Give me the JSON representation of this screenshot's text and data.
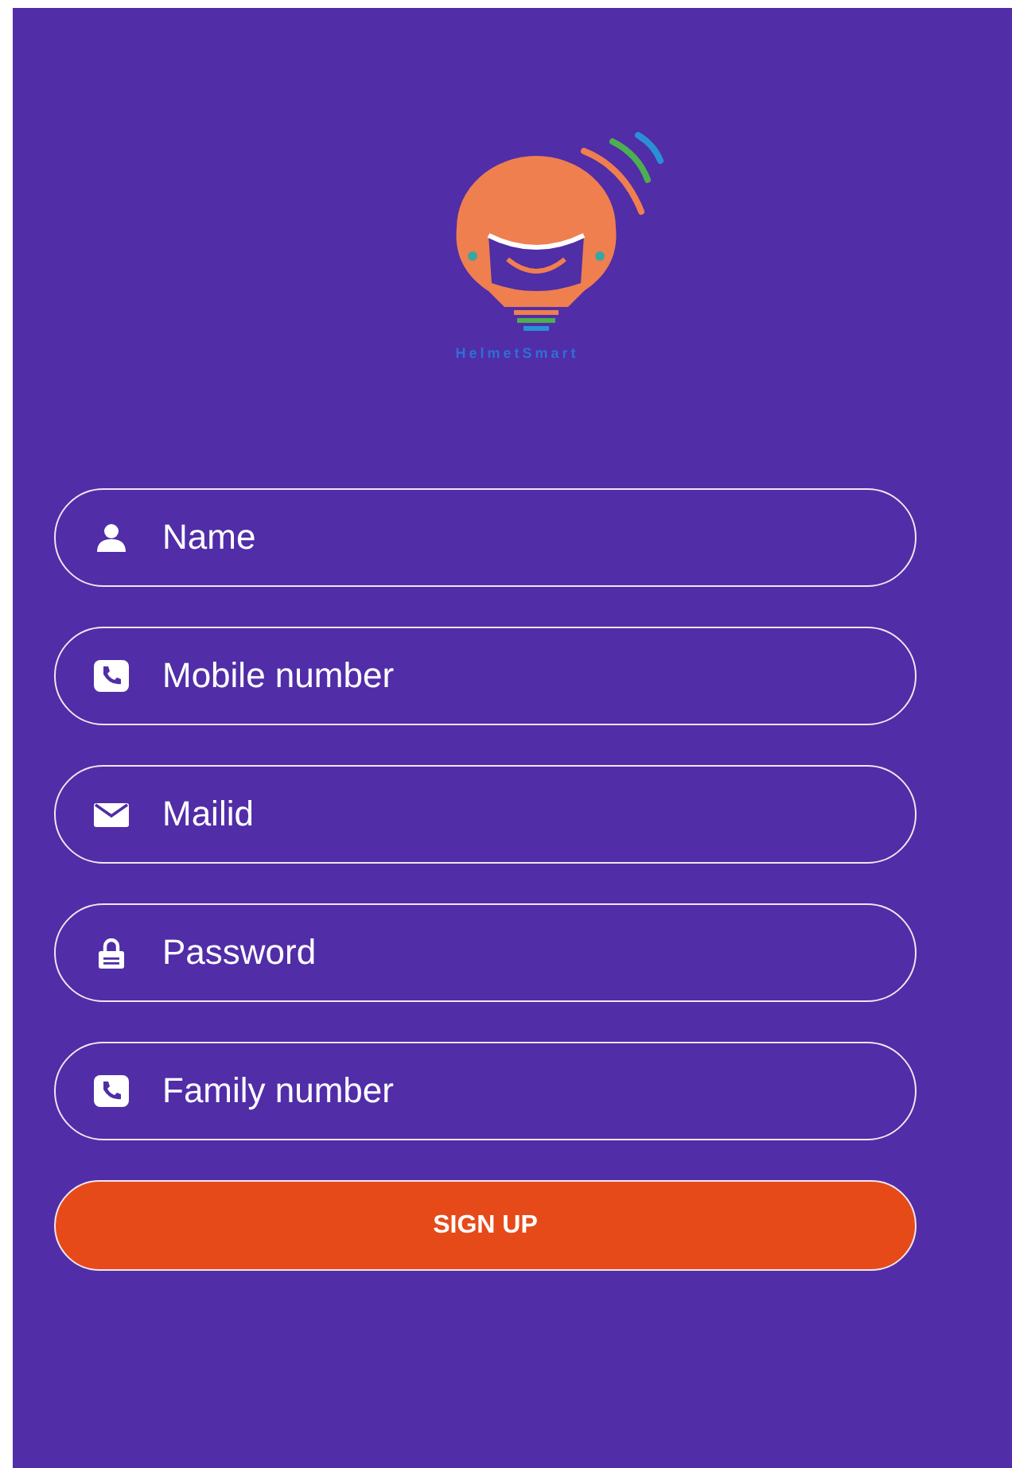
{
  "logo": {
    "caption": "HelmetSmart"
  },
  "fields": [
    {
      "kind": "person",
      "placeholder": "Name"
    },
    {
      "kind": "phone",
      "placeholder": "Mobile number"
    },
    {
      "kind": "mail",
      "placeholder": "Mailid"
    },
    {
      "kind": "lock",
      "placeholder": "Password"
    },
    {
      "kind": "phone",
      "placeholder": "Family number"
    }
  ],
  "submit": {
    "label": "SIGN UP"
  }
}
